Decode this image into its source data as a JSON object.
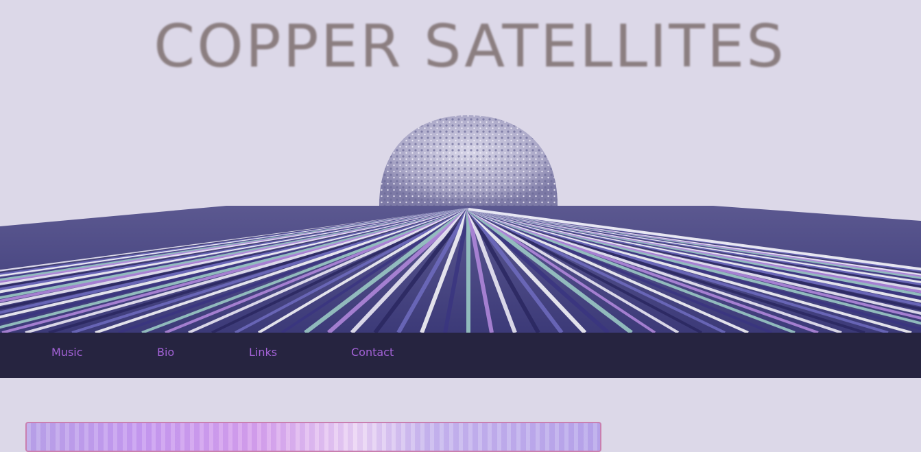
{
  "site": {
    "title": "COPPER SATELLITES"
  },
  "nav": {
    "items": [
      {
        "label": "Music"
      },
      {
        "label": "Bio"
      },
      {
        "label": "Links"
      },
      {
        "label": "Contact"
      }
    ]
  },
  "colors": {
    "background": "#dcd8e8",
    "title_text": "#8b7e80",
    "navbar_bg": "#262440",
    "nav_link": "#a463d8",
    "card_border": "#c97fb0"
  }
}
